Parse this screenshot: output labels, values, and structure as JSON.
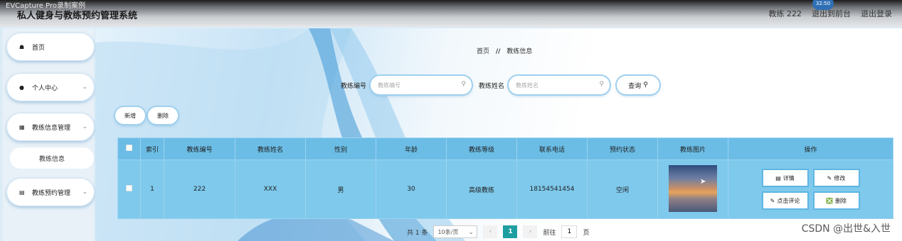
{
  "window": {
    "capture_title": "EVCapture Pro录制案例",
    "rec_time": "32:50"
  },
  "app": {
    "title": "私人健身与教练预约管理系统"
  },
  "header": {
    "user_label": "教练 222",
    "back_home": "退出到前台",
    "logout": "退出登录"
  },
  "sidebar": {
    "items": [
      {
        "label": "首页"
      },
      {
        "label": "个人中心"
      },
      {
        "label": "教练信息管理"
      },
      {
        "label": "教练信息"
      },
      {
        "label": "教练预约管理"
      }
    ]
  },
  "breadcrumb": {
    "home": "首页",
    "separator": "//",
    "current": "教练信息"
  },
  "search": {
    "coach_no_label": "教练编号",
    "coach_no_placeholder": "教练编号",
    "coach_name_label": "教练姓名",
    "coach_name_placeholder": "教练姓名",
    "query_label": "查询"
  },
  "actions": {
    "add": "新增",
    "delete": "删除"
  },
  "table": {
    "headers": [
      "索引",
      "教练编号",
      "教练姓名",
      "性别",
      "年龄",
      "教练等级",
      "联系电话",
      "预约状态",
      "教练图片",
      "操作"
    ],
    "rows": [
      {
        "index": "1",
        "coach_no": "222",
        "coach_name": "XXX",
        "gender": "男",
        "age": "30",
        "level": "高级教练",
        "phone": "18154541454",
        "status": "空闲",
        "ops": {
          "detail": "详情",
          "edit": "修改",
          "review": "点击评论",
          "delete": "删除"
        }
      }
    ]
  },
  "pagination": {
    "total": "共 1 条",
    "page_size": "10条/页",
    "current_page": "1",
    "goto_label": "前往",
    "goto_value": "1",
    "page_suffix": "页"
  },
  "watermark": "CSDN @出世&入世",
  "colors": {
    "table_header": "#6bbde6",
    "table_row": "#7ec9ec",
    "pager_active": "#1d9ea0"
  }
}
